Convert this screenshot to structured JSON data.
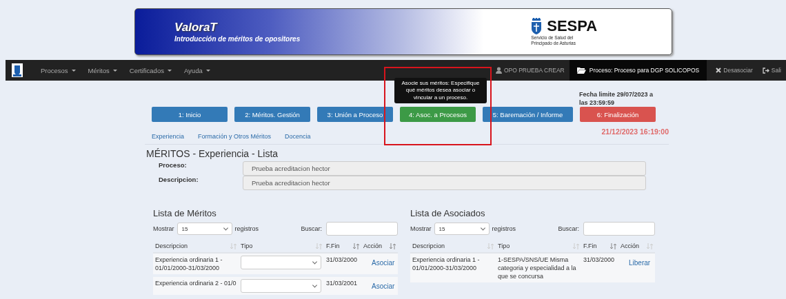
{
  "banner": {
    "title": "ValoraT",
    "subtitle": "Introducción de méritos de opositores",
    "org_name": "SESPA",
    "org_lines": [
      "Servicio de Salud del",
      "Principado de Asturias"
    ]
  },
  "navbar": {
    "menus": [
      {
        "label": "Procesos"
      },
      {
        "label": "Méritos"
      },
      {
        "label": "Certificados"
      },
      {
        "label": "Ayuda"
      }
    ],
    "user": "OPO PRUEBA CREAR",
    "process": "Proceso: Proceso para DGP SOLICOPOS",
    "unlink": "Desasociar",
    "exit": "Sali"
  },
  "deadline": "Fecha limite 29/07/2023 a las 23:59:59",
  "steps": [
    {
      "label": "1: Inicio",
      "color": "#337ab7"
    },
    {
      "label": "2: Méritos. Gestión",
      "color": "#337ab7"
    },
    {
      "label": "3: Unión a Proceso",
      "color": "#337ab7"
    },
    {
      "label": "4: Asoc. a Procesos",
      "color": "#3c9a46",
      "tooltip": "Asocie sus méritos: Especifique qué méritos desea asociar o vincular a un proceso."
    },
    {
      "label": "5: Baremación / Informe",
      "color": "#337ab7"
    },
    {
      "label": "6: Finalización",
      "color": "#d9534f"
    }
  ],
  "clock": "21/12/2023 16:19:00",
  "tabs": [
    {
      "label": "Experiencia"
    },
    {
      "label": "Formación y Otros Méritos"
    },
    {
      "label": "Docencia"
    }
  ],
  "page_title": "MÉRITOS - Experiencia - Lista",
  "form": [
    {
      "label": "Proceso:",
      "value": "Prueba acreditacion hector"
    },
    {
      "label": "Descripcion:",
      "value": "Prueba acreditacion hector"
    }
  ],
  "panels": [
    {
      "title": "Lista de Méritos",
      "show_label": "Mostrar",
      "page_size": "15",
      "show_suffix": "registros",
      "search_label": "Buscar:",
      "columns": [
        {
          "label": "Descripcion",
          "sorted": false
        },
        {
          "label": "Tipo",
          "sorted": false
        },
        {
          "label": "F.Fin",
          "sorted": true
        },
        {
          "label": "Acción",
          "sorted": true
        }
      ],
      "rows": [
        {
          "kind": "select",
          "descripcion": "Experiencia ordinaria 1 - 01/01/2000-31/03/2000",
          "ffin": "31/03/2000",
          "action": "Asociar"
        },
        {
          "kind": "select",
          "descripcion": "Experiencia ordinaria 2 - 01/0",
          "ffin": "31/03/2001",
          "action": "Asociar"
        }
      ]
    },
    {
      "title": "Lista de Asociados",
      "show_label": "Mostrar",
      "page_size": "15",
      "show_suffix": "registros",
      "search_label": "Buscar:",
      "columns": [
        {
          "label": "Descripcion",
          "sorted": false
        },
        {
          "label": "Tipo",
          "sorted": false
        },
        {
          "label": "F.Fin",
          "sorted": true
        },
        {
          "label": "Acción",
          "sorted": false
        }
      ],
      "rows": [
        {
          "kind": "text",
          "descripcion": "Experiencia ordinaria 1 - 01/01/2000-31/03/2000",
          "tipo": "1-SESPA/SNS/UE Misma categoria y especialidad a la que se concursa",
          "ffin": "31/03/2000",
          "action": "Liberar"
        }
      ]
    }
  ]
}
